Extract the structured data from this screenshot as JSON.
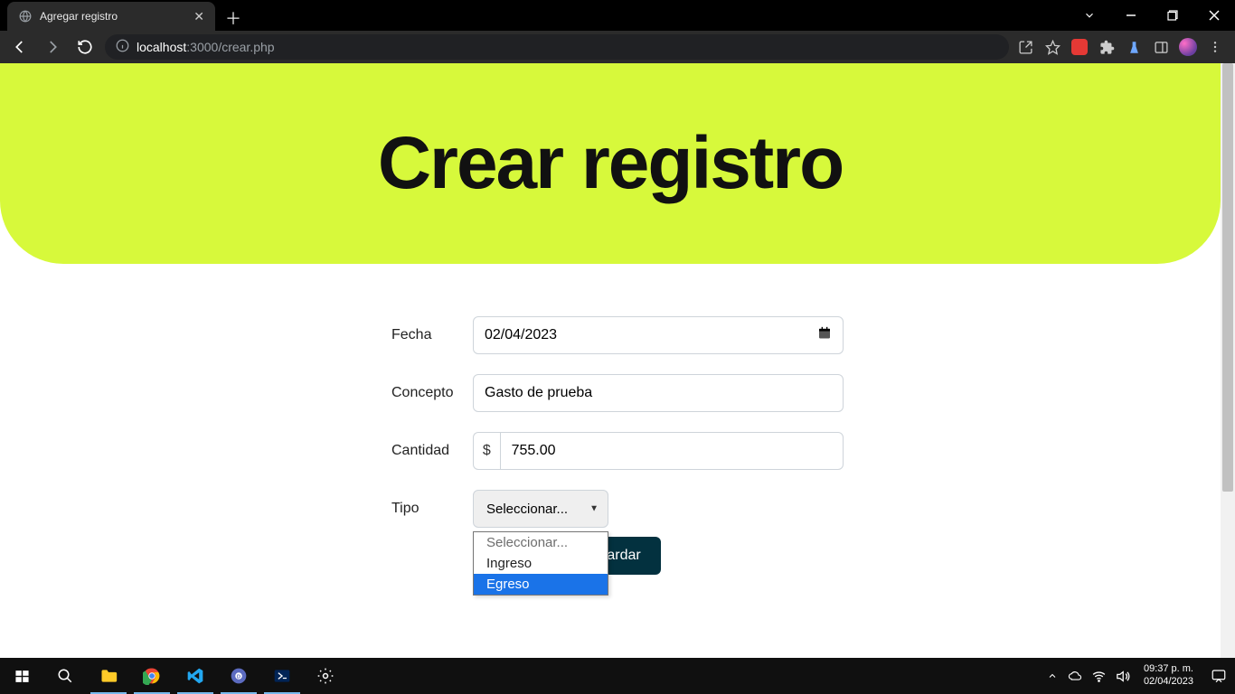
{
  "browser": {
    "tab_title": "Agregar registro",
    "url_host": "localhost",
    "url_port": ":3000",
    "url_path": "/crear.php"
  },
  "page": {
    "hero_title": "Crear registro",
    "form": {
      "fecha_label": "Fecha",
      "fecha_value": "02/04/2023",
      "concepto_label": "Concepto",
      "concepto_value": "Gasto de prueba",
      "cantidad_label": "Cantidad",
      "cantidad_addon": "$",
      "cantidad_value": "755.00",
      "tipo_label": "Tipo",
      "tipo_selected": "Seleccionar...",
      "tipo_options": {
        "placeholder": "Seleccionar...",
        "opt1": "Ingreso",
        "opt2": "Egreso"
      },
      "submit_label": "Guardar"
    }
  },
  "taskbar": {
    "time": "09:37 p. m.",
    "date": "02/04/2023"
  }
}
